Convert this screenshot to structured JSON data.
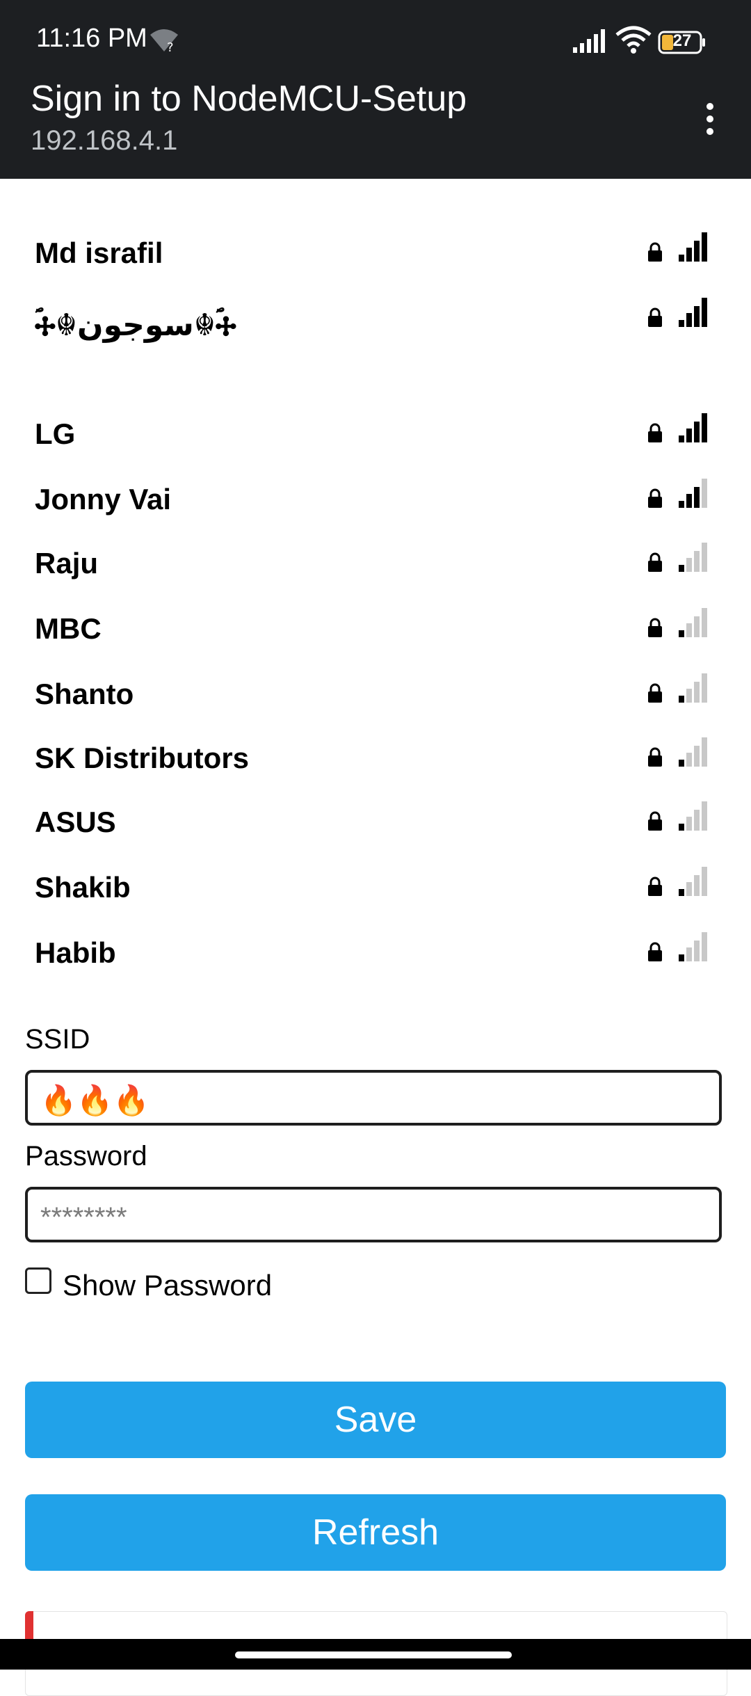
{
  "status": {
    "time": "11:16 PM",
    "battery": "27"
  },
  "header": {
    "title": "Sign in to NodeMCU-Setup",
    "subtitle": "192.168.4.1"
  },
  "networks": [
    {
      "name": "Md israfil",
      "strength": 4
    },
    {
      "name": "ؐ🕂☬سوجون☬🕂ؐ",
      "strength": 4
    },
    {
      "name": "LG",
      "strength": 4
    },
    {
      "name": "Jonny Vai",
      "strength": 3
    },
    {
      "name": "Raju",
      "strength": 1
    },
    {
      "name": "MBC",
      "strength": 1
    },
    {
      "name": "Shanto",
      "strength": 1
    },
    {
      "name": "SK Distributors",
      "strength": 1
    },
    {
      "name": "ASUS",
      "strength": 1
    },
    {
      "name": "Shakib",
      "strength": 1
    },
    {
      "name": "Habib",
      "strength": 1
    }
  ],
  "form": {
    "ssid_label": "SSID",
    "ssid_value": "🔥🔥🔥",
    "password_label": "Password",
    "password_placeholder": "********",
    "show_password_label": "Show Password",
    "save_label": "Save",
    "refresh_label": "Refresh"
  },
  "colors": {
    "appbar": "#1d1f22",
    "button": "#21a2e9",
    "accent": "#e03131"
  }
}
